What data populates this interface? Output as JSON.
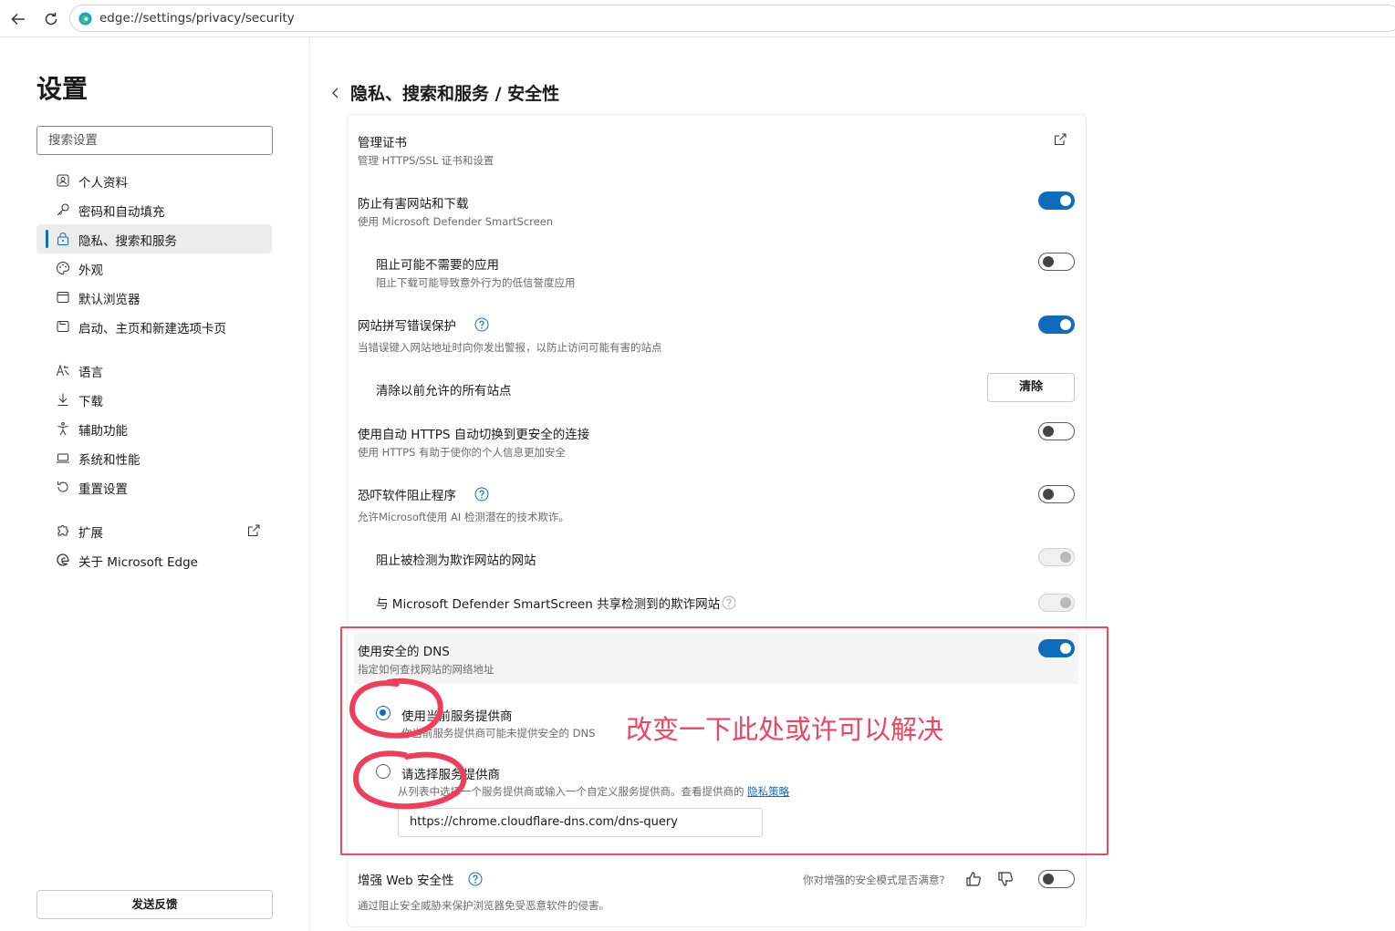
{
  "browser": {
    "url": "edge://settings/privacy/security"
  },
  "sidebar": {
    "title": "设置",
    "search_placeholder": "搜索设置",
    "items": [
      {
        "label": "个人资料",
        "icon": "profile-icon"
      },
      {
        "label": "密码和自动填充",
        "icon": "key-icon"
      },
      {
        "label": "隐私、搜索和服务",
        "icon": "lock-icon",
        "active": true
      },
      {
        "label": "外观",
        "icon": "palette-icon"
      },
      {
        "label": "默认浏览器",
        "icon": "browser-icon"
      },
      {
        "label": "启动、主页和新建选项卡页",
        "icon": "home-icon"
      },
      {
        "label": "语言",
        "icon": "language-icon"
      },
      {
        "label": "下载",
        "icon": "download-icon"
      },
      {
        "label": "辅助功能",
        "icon": "accessibility-icon"
      },
      {
        "label": "系统和性能",
        "icon": "laptop-icon"
      },
      {
        "label": "重置设置",
        "icon": "reset-icon"
      },
      {
        "label": "扩展",
        "icon": "puzzle-icon"
      },
      {
        "label": "关于 Microsoft Edge",
        "icon": "edge-icon"
      }
    ],
    "feedback_label": "发送反馈"
  },
  "main": {
    "breadcrumb": "隐私、搜索和服务 / 安全性",
    "rows": {
      "certs": {
        "title": "管理证书",
        "sub": "管理 HTTPS/SSL 证书和设置"
      },
      "smartscreen": {
        "title": "防止有害网站和下载",
        "sub": "使用 Microsoft Defender SmartScreen",
        "on": true
      },
      "pua": {
        "title": "阻止可能不需要的应用",
        "sub": "阻止下载可能导致意外行为的低信誉度应用",
        "on": false
      },
      "typo": {
        "title": "网站拼写错误保护",
        "sub": "当错误键入网站地址时向你发出警报，以防止访问可能有害的站点",
        "on": true
      },
      "clear_sites": {
        "title": "清除以前允许的所有站点",
        "button": "清除"
      },
      "auto_https": {
        "title": "使用自动 HTTPS 自动切换到更安全的连接",
        "sub": "使用 HTTPS 有助于使你的个人信息更加安全",
        "on": false
      },
      "scareware": {
        "title": "恐吓软件阻止程序",
        "sub": "允许Microsoft使用 AI 检测潜在的技术欺诈。",
        "on": false
      },
      "block_scam": {
        "title": "阻止被检测为欺诈网站的网站",
        "disabled": true
      },
      "share_scam": {
        "title": "与 Microsoft Defender SmartScreen 共享检测到的欺诈网站",
        "disabled": true
      },
      "secure_dns": {
        "title": "使用安全的 DNS",
        "sub": "指定如何查找网站的网络地址",
        "on": true
      },
      "dns_current": {
        "title": "使用当前服务提供商",
        "sub": "你当前服务提供商可能未提供安全的 DNS",
        "checked": true
      },
      "dns_choose": {
        "title": "请选择服务提供商",
        "sub": "从列表中选择一个服务提供商或输入一个自定义服务提供商。查看提供商的",
        "link": "隐私策略",
        "checked": false,
        "value": "https://chrome.cloudflare-dns.com/dns-query"
      },
      "enhanced": {
        "title": "增强 Web 安全性",
        "sub": "通过阻止安全威胁来保护浏览器免受恶意软件的侵害。",
        "question": "你对增强的安全模式是否满意?",
        "on": false
      }
    },
    "annotation": "改变一下此处或许可以解决"
  },
  "colors": {
    "accent": "#0f6cbd",
    "annotation_red": "#ea4a5f"
  }
}
